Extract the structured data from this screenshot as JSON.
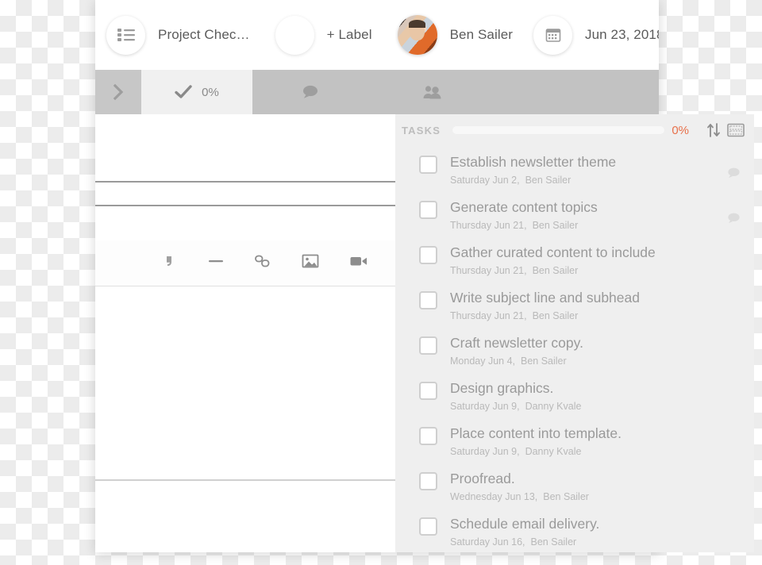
{
  "header": {
    "list_icon": "list-icon",
    "title": "Project Chec…",
    "label_button": "+ Label",
    "avatar_icon": "user-avatar",
    "assignee": "Ben Sailer",
    "calendar_icon": "calendar-icon",
    "due_date": "Jun 23, 2018 …"
  },
  "tabs": {
    "expand_icon": "chevron-right-icon",
    "tasks": {
      "icon": "check-icon",
      "label": "0%"
    },
    "comments": {
      "icon": "comment-bubble-icon",
      "label": ""
    },
    "people": {
      "icon": "people-icon",
      "label": ""
    }
  },
  "tasks_bar": {
    "title": "TASKS",
    "progress_percent": 0,
    "progress_label": "0%",
    "sort_icon": "sort-arrows-icon",
    "keyboard_icon": "keyboard-icon",
    "accent_color": "#e8704a"
  },
  "editor_toolbar": {
    "icons": [
      "quote-icon",
      "horizontal-rule-icon",
      "link-icon",
      "image-icon",
      "video-icon"
    ]
  },
  "tasks": [
    {
      "title": "Establish newsletter theme",
      "date": "Saturday Jun 2,",
      "assignee": "Ben Sailer",
      "has_comment": true
    },
    {
      "title": "Generate content topics",
      "date": "Thursday Jun 21,",
      "assignee": "Ben Sailer",
      "has_comment": true
    },
    {
      "title": "Gather curated content to include",
      "date": "Thursday Jun 21,",
      "assignee": "Ben Sailer",
      "has_comment": false
    },
    {
      "title": "Write subject line and subhead",
      "date": "Thursday Jun 21,",
      "assignee": "Ben Sailer",
      "has_comment": false
    },
    {
      "title": "Craft newsletter copy.",
      "date": "Monday Jun 4,",
      "assignee": "Ben Sailer",
      "has_comment": false
    },
    {
      "title": "Design graphics.",
      "date": "Saturday Jun 9,",
      "assignee": "Danny Kvale",
      "has_comment": false
    },
    {
      "title": "Place content into template.",
      "date": "Saturday Jun 9,",
      "assignee": "Danny Kvale",
      "has_comment": false
    },
    {
      "title": "Proofread.",
      "date": "Wednesday Jun 13,",
      "assignee": "Ben Sailer",
      "has_comment": false
    },
    {
      "title": "Schedule email delivery.",
      "date": "Saturday Jun 16,",
      "assignee": "Ben Sailer",
      "has_comment": false
    }
  ]
}
